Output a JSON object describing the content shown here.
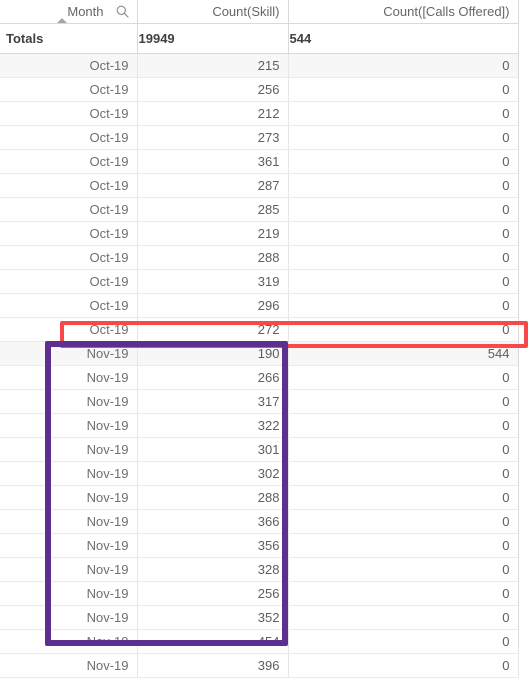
{
  "app": {
    "type": "data-table",
    "sort_column": "Month",
    "sort_direction": "ascending",
    "cursor_icon": "mouse-pointer-icon",
    "search_icon": "magnifier-icon"
  },
  "table": {
    "columns": [
      {
        "label": "Month",
        "align": "right",
        "has_search": true,
        "sorted": true
      },
      {
        "label": "Count(Skill)",
        "align": "right",
        "has_search": false,
        "sorted": false
      },
      {
        "label": "Count([Calls Offered])",
        "align": "right",
        "has_search": false,
        "sorted": false
      }
    ],
    "totals": {
      "label": "Totals",
      "skill": "19949",
      "calls_offered": "544"
    },
    "rows": [
      {
        "month": "Oct-19",
        "skill": "215",
        "calls": "0"
      },
      {
        "month": "Oct-19",
        "skill": "256",
        "calls": "0"
      },
      {
        "month": "Oct-19",
        "skill": "212",
        "calls": "0"
      },
      {
        "month": "Oct-19",
        "skill": "273",
        "calls": "0"
      },
      {
        "month": "Oct-19",
        "skill": "361",
        "calls": "0"
      },
      {
        "month": "Oct-19",
        "skill": "287",
        "calls": "0"
      },
      {
        "month": "Oct-19",
        "skill": "285",
        "calls": "0"
      },
      {
        "month": "Oct-19",
        "skill": "219",
        "calls": "0"
      },
      {
        "month": "Oct-19",
        "skill": "288",
        "calls": "0"
      },
      {
        "month": "Oct-19",
        "skill": "319",
        "calls": "0"
      },
      {
        "month": "Oct-19",
        "skill": "296",
        "calls": "0"
      },
      {
        "month": "Oct-19",
        "skill": "272",
        "calls": "0"
      },
      {
        "month": "Nov-19",
        "skill": "190",
        "calls": "544"
      },
      {
        "month": "Nov-19",
        "skill": "266",
        "calls": "0"
      },
      {
        "month": "Nov-19",
        "skill": "317",
        "calls": "0"
      },
      {
        "month": "Nov-19",
        "skill": "322",
        "calls": "0"
      },
      {
        "month": "Nov-19",
        "skill": "301",
        "calls": "0"
      },
      {
        "month": "Nov-19",
        "skill": "302",
        "calls": "0"
      },
      {
        "month": "Nov-19",
        "skill": "288",
        "calls": "0"
      },
      {
        "month": "Nov-19",
        "skill": "366",
        "calls": "0"
      },
      {
        "month": "Nov-19",
        "skill": "356",
        "calls": "0"
      },
      {
        "month": "Nov-19",
        "skill": "328",
        "calls": "0"
      },
      {
        "month": "Nov-19",
        "skill": "256",
        "calls": "0"
      },
      {
        "month": "Nov-19",
        "skill": "352",
        "calls": "0"
      },
      {
        "month": "Nov-19",
        "skill": "454",
        "calls": "0"
      },
      {
        "month": "Nov-19",
        "skill": "396",
        "calls": "0"
      }
    ]
  },
  "annotations": [
    {
      "name": "red-highlight-box",
      "color": "#f8484a",
      "targets_row_index": 12
    },
    {
      "name": "purple-highlight-box",
      "color": "#5f2f8f",
      "targets_row_range": "13-25"
    }
  ]
}
